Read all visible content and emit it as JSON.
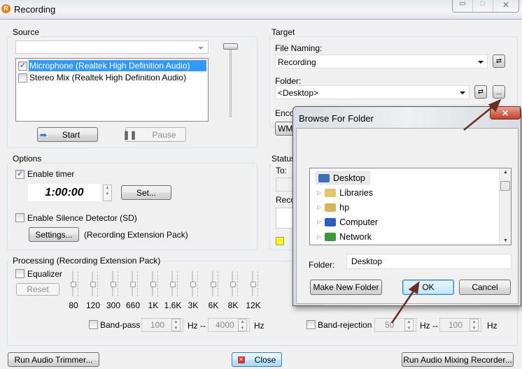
{
  "window": {
    "title": "Recording"
  },
  "source": {
    "label": "Source",
    "devices": [
      {
        "label": "Microphone (Realtek High Definition Audio)",
        "checked": true,
        "selected": true
      },
      {
        "label": "Stereo Mix (Realtek High Definition Audio)",
        "checked": false,
        "selected": false
      }
    ],
    "start": "Start",
    "pause": "Pause"
  },
  "target": {
    "label": "Target",
    "file_naming_label": "File Naming:",
    "file_naming": "Recording",
    "folder_label": "Folder:",
    "folder": "<Desktop>",
    "browse": "...",
    "encoder_label": "Enco",
    "encoder": "WMA"
  },
  "status": {
    "label": "Status",
    "to_label": "To:",
    "rec_label": "Reco",
    "indicator_color": "#ffff00"
  },
  "options": {
    "label": "Options",
    "enable_timer": "Enable timer",
    "timer_value": "1:00:00",
    "set": "Set...",
    "silence": "Enable Silence Detector (SD)",
    "settings": "Settings...",
    "ext_note": "(Recording Extension Pack)"
  },
  "processing": {
    "label": "Processing (Recording Extension Pack)",
    "equalizer": "Equalizer",
    "reset": "Reset",
    "bands": [
      "80",
      "120",
      "300",
      "660",
      "1K",
      "1.6K",
      "3K",
      "6K",
      "8K",
      "12K"
    ],
    "bandpass": "Band-pass",
    "bp_from": "100",
    "bp_to": "4000",
    "hz_sep": "Hz --",
    "hz": "Hz",
    "bandrej": "Band-rejection",
    "br_from": "50",
    "br_to": "100"
  },
  "footer": {
    "trimmer": "Run Audio Trimmer...",
    "close": "Close",
    "mixing": "Run Audio Mixing Recorder..."
  },
  "dialog": {
    "title": "Browse For Folder",
    "tree": [
      "Desktop",
      "Libraries",
      "hp",
      "Computer",
      "Network"
    ],
    "folder_label": "Folder:",
    "folder_value": "Desktop",
    "make_new": "Make New Folder",
    "ok": "OK",
    "cancel": "Cancel"
  }
}
